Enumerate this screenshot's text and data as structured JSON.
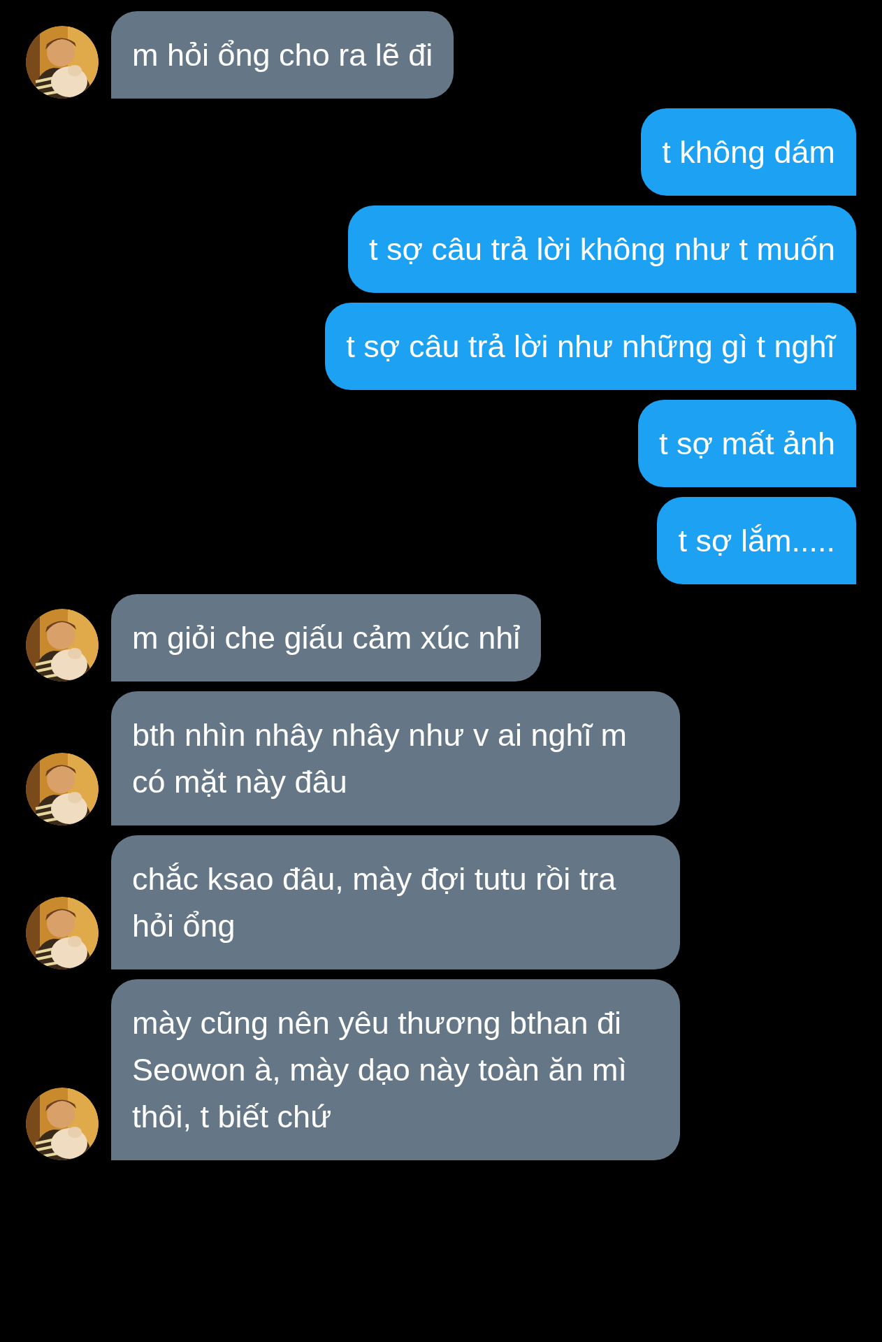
{
  "messages": [
    {
      "kind": "received",
      "text": "m hỏi ổng cho ra lẽ đi"
    },
    {
      "kind": "sent",
      "text": "t không dám"
    },
    {
      "kind": "sent",
      "text": "t sợ câu trả lời không như t muốn"
    },
    {
      "kind": "sent",
      "text": "t sợ câu trả lời như những gì t nghĩ"
    },
    {
      "kind": "sent",
      "text": "t sợ mất ảnh"
    },
    {
      "kind": "sent",
      "text": "t sợ lắm....."
    },
    {
      "kind": "received",
      "text": "m giỏi che giấu cảm xúc nhỉ"
    },
    {
      "kind": "received",
      "text": "bth nhìn nhây nhây như v ai nghĩ m có mặt này đâu"
    },
    {
      "kind": "received",
      "text": "chắc ksao đâu, mày đợi tutu rồi tra hỏi ổng"
    },
    {
      "kind": "received",
      "text": "mày cũng nên yêu thương bthan đi Seowon à, mày dạo này toàn ăn mì thôi, t biết chứ"
    }
  ]
}
